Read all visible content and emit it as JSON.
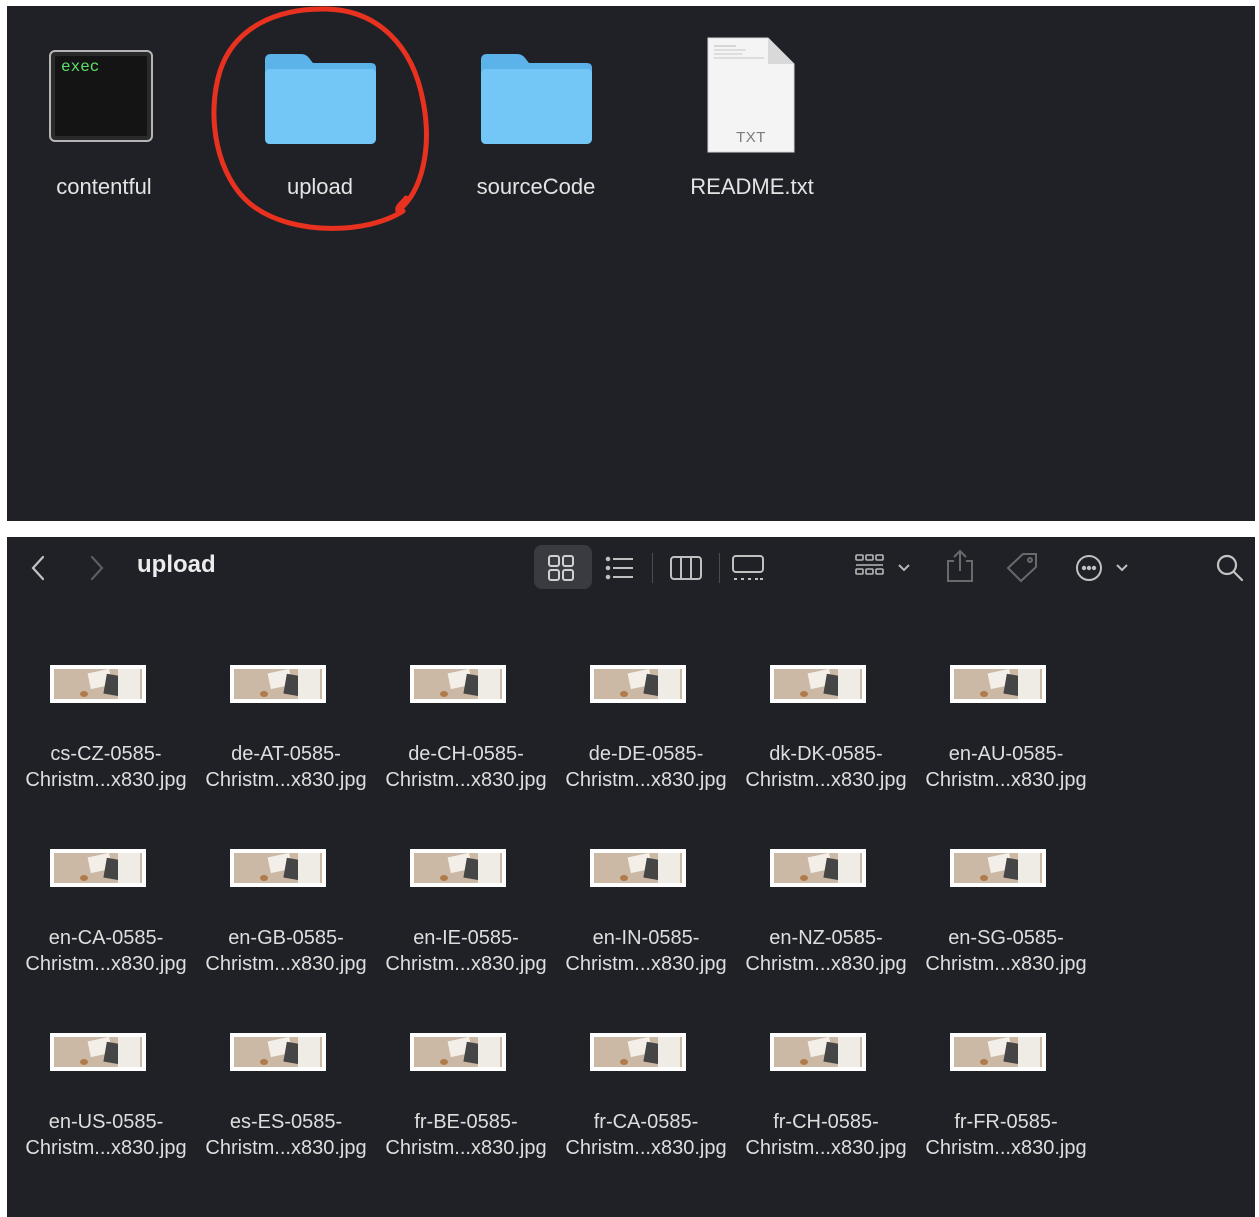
{
  "top_panel": {
    "items": [
      {
        "label": "contentful",
        "icon": "terminal-exec-icon",
        "icon_text": "exec"
      },
      {
        "label": "upload",
        "icon": "folder-icon"
      },
      {
        "label": "sourceCode",
        "icon": "folder-icon"
      },
      {
        "label": "README.txt",
        "icon": "text-document-icon",
        "icon_text": "TXT"
      }
    ],
    "annotation_color": "#e8321f"
  },
  "finder": {
    "title": "upload",
    "toolbar_icons": [
      "back-icon",
      "forward-icon",
      "icon-view-icon",
      "list-view-icon",
      "column-view-icon",
      "gallery-view-icon",
      "group-icon",
      "share-icon",
      "tag-icon",
      "more-actions-icon",
      "search-icon"
    ],
    "files": [
      {
        "line1": "cs-CZ-0585-",
        "line2": "Christm...x830.jpg"
      },
      {
        "line1": "de-AT-0585-",
        "line2": "Christm...x830.jpg"
      },
      {
        "line1": "de-CH-0585-",
        "line2": "Christm...x830.jpg"
      },
      {
        "line1": "de-DE-0585-",
        "line2": "Christm...x830.jpg"
      },
      {
        "line1": "dk-DK-0585-",
        "line2": "Christm...x830.jpg"
      },
      {
        "line1": "en-AU-0585-",
        "line2": "Christm...x830.jpg"
      },
      {
        "line1": "en-CA-0585-",
        "line2": "Christm...x830.jpg"
      },
      {
        "line1": "en-GB-0585-",
        "line2": "Christm...x830.jpg"
      },
      {
        "line1": "en-IE-0585-",
        "line2": "Christm...x830.jpg"
      },
      {
        "line1": "en-IN-0585-",
        "line2": "Christm...x830.jpg"
      },
      {
        "line1": "en-NZ-0585-",
        "line2": "Christm...x830.jpg"
      },
      {
        "line1": "en-SG-0585-",
        "line2": "Christm...x830.jpg"
      },
      {
        "line1": "en-US-0585-",
        "line2": "Christm...x830.jpg"
      },
      {
        "line1": "es-ES-0585-",
        "line2": "Christm...x830.jpg"
      },
      {
        "line1": "fr-BE-0585-",
        "line2": "Christm...x830.jpg"
      },
      {
        "line1": "fr-CA-0585-",
        "line2": "Christm...x830.jpg"
      },
      {
        "line1": "fr-CH-0585-",
        "line2": "Christm...x830.jpg"
      },
      {
        "line1": "fr-FR-0585-",
        "line2": "Christm...x830.jpg"
      }
    ]
  },
  "colors": {
    "background": "#1f2126",
    "folder": "#6cc4f5",
    "text": "#e4e4e4"
  }
}
